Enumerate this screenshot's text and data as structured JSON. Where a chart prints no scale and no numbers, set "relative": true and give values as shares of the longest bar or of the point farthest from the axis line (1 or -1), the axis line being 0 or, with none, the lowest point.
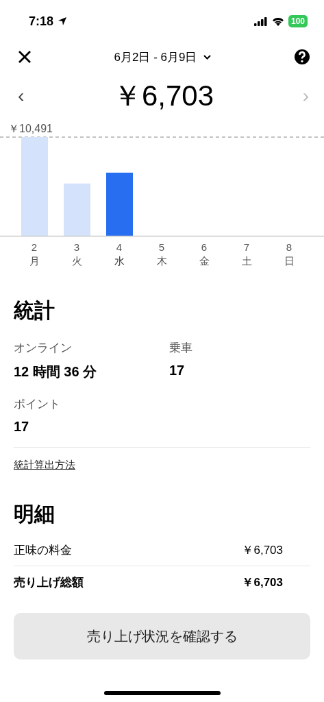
{
  "status_bar": {
    "time": "7:18",
    "battery": "100"
  },
  "header": {
    "date_range": "6月2日 - 6月9日"
  },
  "amount": {
    "value": "￥6,703",
    "prev": "‹",
    "next": "›",
    "prev_enabled": true,
    "next_enabled": false
  },
  "chart": {
    "chart_data": {
      "type": "bar",
      "categories": [
        "2",
        "3",
        "4",
        "5",
        "6",
        "7",
        "8"
      ],
      "values": [
        1,
        0.53,
        0.64,
        null,
        null,
        null,
        null
      ],
      "relative": true,
      "annotations": [
        {
          "text": "￥10,491"
        }
      ]
    },
    "days": [
      {
        "weekday": "月",
        "selected": false
      },
      {
        "weekday": "火",
        "selected": false
      },
      {
        "weekday": "水",
        "selected": true
      },
      {
        "weekday": "木",
        "selected": false
      },
      {
        "weekday": "金",
        "selected": false
      },
      {
        "weekday": "土",
        "selected": false
      },
      {
        "weekday": "日",
        "selected": false
      }
    ]
  },
  "stats": {
    "title": "統計",
    "items": [
      {
        "label": "オンライン",
        "value": "12 時間 36 分"
      },
      {
        "label": "乗車",
        "value": "17"
      },
      {
        "label": "ポイント",
        "value": "17"
      }
    ],
    "link": "統計算出方法"
  },
  "details": {
    "title": "明細",
    "rows": [
      {
        "label": "正味の料金",
        "value": "￥6,703",
        "bold": false
      },
      {
        "label": "売り上げ総額",
        "value": "￥6,703",
        "bold": true
      }
    ]
  },
  "button": "売り上げ状況を確認する"
}
